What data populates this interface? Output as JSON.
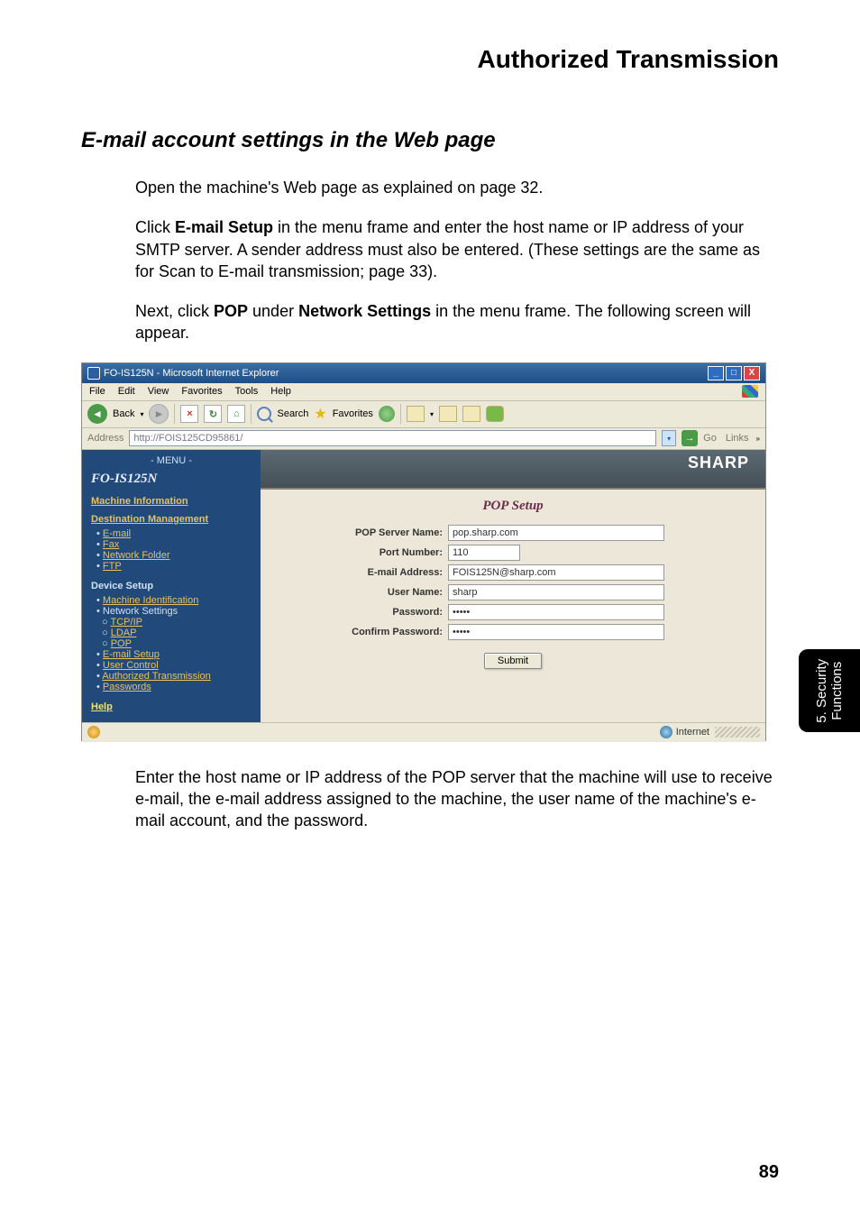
{
  "chapter_title": "Authorized Transmission",
  "section_title": "E-mail account settings in the Web page",
  "para1": "Open the machine's Web page as explained on page 32.",
  "para2_pre": "Click ",
  "para2_b1": "E-mail Setup",
  "para2_post": " in the menu frame and enter the host name or IP address of your SMTP server. A sender address must also be entered. (These settings are the same as for Scan to E-mail transmission; page 33).",
  "para3_pre": "Next, click ",
  "para3_b1": "POP",
  "para3_mid": " under ",
  "para3_b2": "Network Settings",
  "para3_post": " in the menu frame. The following screen will appear.",
  "para4": "Enter the host name or IP address of the POP server that the machine will use to receive e-mail, the e-mail address assigned to the machine, the user name of the machine's e-mail account, and the password.",
  "page_number": "89",
  "thumb_tab": {
    "line1": "5. Security",
    "line2": "Functions"
  },
  "browser": {
    "title": "FO-IS125N - Microsoft Internet Explorer",
    "menus": {
      "file": "File",
      "edit": "Edit",
      "view": "View",
      "favorites": "Favorites",
      "tools": "Tools",
      "help": "Help"
    },
    "toolbar": {
      "back": "Back",
      "search": "Search",
      "favorites": "Favorites"
    },
    "addressbar": {
      "label": "Address",
      "url": "http://FOIS125CD95861/",
      "go": "Go",
      "links": "Links"
    },
    "statusbar": {
      "zone": "Internet"
    }
  },
  "sidebar": {
    "menu_header": "- MENU -",
    "model": "FO-IS125N",
    "machine_info": "Machine Information",
    "dest_mgmt": "Destination Management",
    "dest_items": {
      "email": "E-mail",
      "fax": "Fax",
      "network_folder": "Network Folder",
      "ftp": "FTP"
    },
    "device_setup": "Device Setup",
    "device_items": {
      "machine_id": "Machine Identification",
      "net_settings": "Network Settings",
      "tcpip": "TCP/IP",
      "ldap": "LDAP",
      "pop": "POP",
      "email_setup": "E-mail Setup",
      "user_control": "User Control",
      "auth_tx": "Authorized Transmission",
      "passwords": "Passwords"
    },
    "help": "Help"
  },
  "form": {
    "banner_brand": "SHARP",
    "title": "POP Setup",
    "labels": {
      "server": "POP Server Name:",
      "port": "Port Number:",
      "email": "E-mail Address:",
      "user": "User Name:",
      "pass": "Password:",
      "confirm": "Confirm Password:"
    },
    "values": {
      "server": "pop.sharp.com",
      "port": "110",
      "email": "FOIS125N@sharp.com",
      "user": "sharp",
      "pass": "•••••",
      "confirm": "•••••"
    },
    "submit": "Submit"
  }
}
